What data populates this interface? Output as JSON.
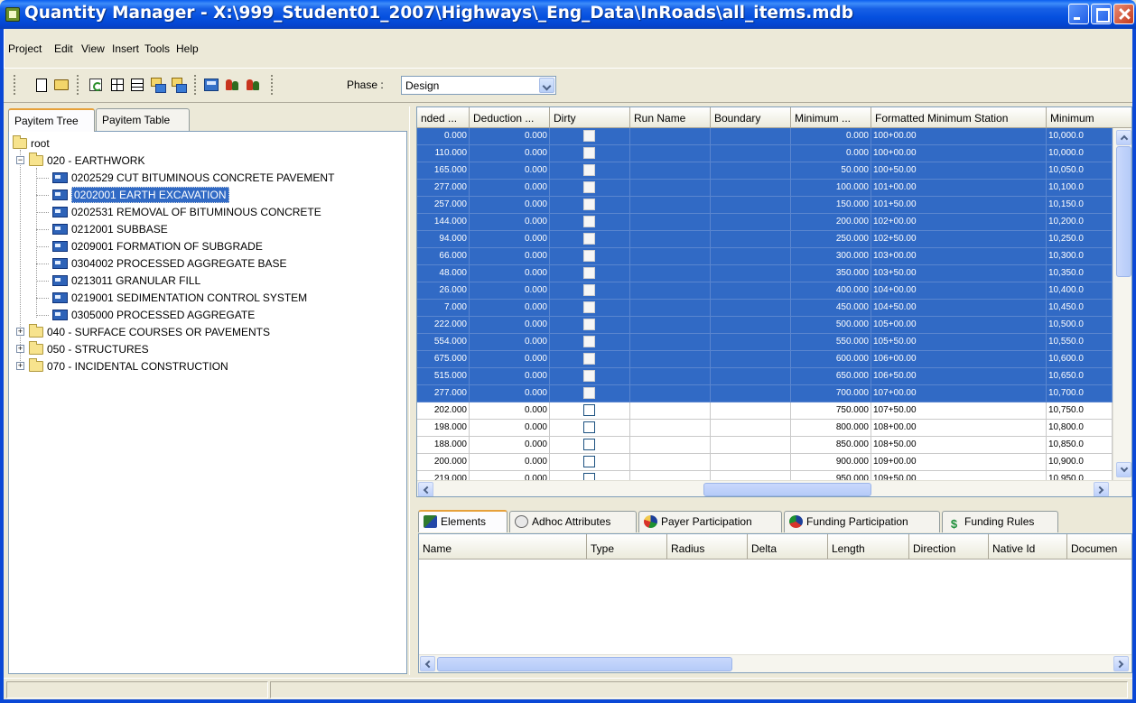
{
  "window": {
    "title": "Quantity Manager - X:\\999_Student01_2007\\Highways\\_Eng_Data\\InRoads\\all_items.mdb"
  },
  "menu": [
    "Project",
    "Edit",
    "View",
    "Insert",
    "Tools",
    "Help"
  ],
  "toolbar": {
    "buttons": [
      "new-icon",
      "open-icon",
      "refresh-icon",
      "grid-icon",
      "rows-icon",
      "multi-icon",
      "multi-icon",
      "calculator-icon",
      "people-icon",
      "people-icon"
    ],
    "phase_label": "Phase :",
    "phase_value": "Design"
  },
  "left": {
    "tabs": [
      "Payitem Tree",
      "Payitem Table"
    ],
    "tree": {
      "root": "root",
      "groups": [
        {
          "label": "020 - EARTHWORK",
          "expanded": true,
          "items": [
            "0202529 CUT BITUMINOUS CONCRETE PAVEMENT",
            "0202001 EARTH EXCAVATION",
            "0202531 REMOVAL OF BITUMINOUS CONCRETE",
            "0212001 SUBBASE",
            "0209001 FORMATION OF SUBGRADE",
            "0304002 PROCESSED AGGREGATE BASE",
            "0213011 GRANULAR FILL",
            "0219001 SEDIMENTATION CONTROL SYSTEM",
            "0305000 PROCESSED AGGREGATE"
          ]
        },
        {
          "label": "040 - SURFACE COURSES OR PAVEMENTS",
          "expanded": false
        },
        {
          "label": "050 - STRUCTURES",
          "expanded": false
        },
        {
          "label": "070 - INCIDENTAL CONSTRUCTION",
          "expanded": false
        }
      ],
      "selected": "0202001 EARTH EXCAVATION"
    }
  },
  "grid": {
    "columns": [
      "nded ...",
      "Deduction ...",
      "Dirty",
      "Run Name",
      "Boundary",
      "Minimum ...",
      "Formatted Minimum Station",
      "Minimum"
    ],
    "rows": [
      {
        "a": "0.000",
        "b": "0.000",
        "min": "0.000",
        "station": "100+00.00",
        "min2": "10,000.0",
        "selected": true
      },
      {
        "a": "110.000",
        "b": "0.000",
        "min": "0.000",
        "station": "100+00.00",
        "min2": "10,000.0",
        "selected": true
      },
      {
        "a": "165.000",
        "b": "0.000",
        "min": "50.000",
        "station": "100+50.00",
        "min2": "10,050.0",
        "selected": true
      },
      {
        "a": "277.000",
        "b": "0.000",
        "min": "100.000",
        "station": "101+00.00",
        "min2": "10,100.0",
        "selected": true
      },
      {
        "a": "257.000",
        "b": "0.000",
        "min": "150.000",
        "station": "101+50.00",
        "min2": "10,150.0",
        "selected": true
      },
      {
        "a": "144.000",
        "b": "0.000",
        "min": "200.000",
        "station": "102+00.00",
        "min2": "10,200.0",
        "selected": true
      },
      {
        "a": "94.000",
        "b": "0.000",
        "min": "250.000",
        "station": "102+50.00",
        "min2": "10,250.0",
        "selected": true
      },
      {
        "a": "66.000",
        "b": "0.000",
        "min": "300.000",
        "station": "103+00.00",
        "min2": "10,300.0",
        "selected": true
      },
      {
        "a": "48.000",
        "b": "0.000",
        "min": "350.000",
        "station": "103+50.00",
        "min2": "10,350.0",
        "selected": true
      },
      {
        "a": "26.000",
        "b": "0.000",
        "min": "400.000",
        "station": "104+00.00",
        "min2": "10,400.0",
        "selected": true
      },
      {
        "a": "7.000",
        "b": "0.000",
        "min": "450.000",
        "station": "104+50.00",
        "min2": "10,450.0",
        "selected": true
      },
      {
        "a": "222.000",
        "b": "0.000",
        "min": "500.000",
        "station": "105+00.00",
        "min2": "10,500.0",
        "selected": true
      },
      {
        "a": "554.000",
        "b": "0.000",
        "min": "550.000",
        "station": "105+50.00",
        "min2": "10,550.0",
        "selected": true
      },
      {
        "a": "675.000",
        "b": "0.000",
        "min": "600.000",
        "station": "106+00.00",
        "min2": "10,600.0",
        "selected": true
      },
      {
        "a": "515.000",
        "b": "0.000",
        "min": "650.000",
        "station": "106+50.00",
        "min2": "10,650.0",
        "selected": true
      },
      {
        "a": "277.000",
        "b": "0.000",
        "min": "700.000",
        "station": "107+00.00",
        "min2": "10,700.0",
        "selected": true
      },
      {
        "a": "202.000",
        "b": "0.000",
        "min": "750.000",
        "station": "107+50.00",
        "min2": "10,750.0",
        "selected": false
      },
      {
        "a": "198.000",
        "b": "0.000",
        "min": "800.000",
        "station": "108+00.00",
        "min2": "10,800.0",
        "selected": false
      },
      {
        "a": "188.000",
        "b": "0.000",
        "min": "850.000",
        "station": "108+50.00",
        "min2": "10,850.0",
        "selected": false
      },
      {
        "a": "200.000",
        "b": "0.000",
        "min": "900.000",
        "station": "109+00.00",
        "min2": "10,900.0",
        "selected": false
      },
      {
        "a": "219.000",
        "b": "0.000",
        "min": "950.000",
        "station": "109+50.00",
        "min2": "10,950.0",
        "selected": false
      }
    ]
  },
  "bottom": {
    "tabs": [
      {
        "label": "Elements",
        "icon": "elements-icon"
      },
      {
        "label": "Adhoc Attributes",
        "icon": "adhoc-attributes-icon"
      },
      {
        "label": "Payer Participation",
        "icon": "payer-participation-icon"
      },
      {
        "label": "Funding Participation",
        "icon": "funding-participation-icon"
      },
      {
        "label": "Funding Rules",
        "icon": "funding-rules-icon"
      }
    ],
    "columns": [
      "Name",
      "Type",
      "Radius",
      "Delta",
      "Length",
      "Direction",
      "Native Id",
      "Documen"
    ]
  }
}
